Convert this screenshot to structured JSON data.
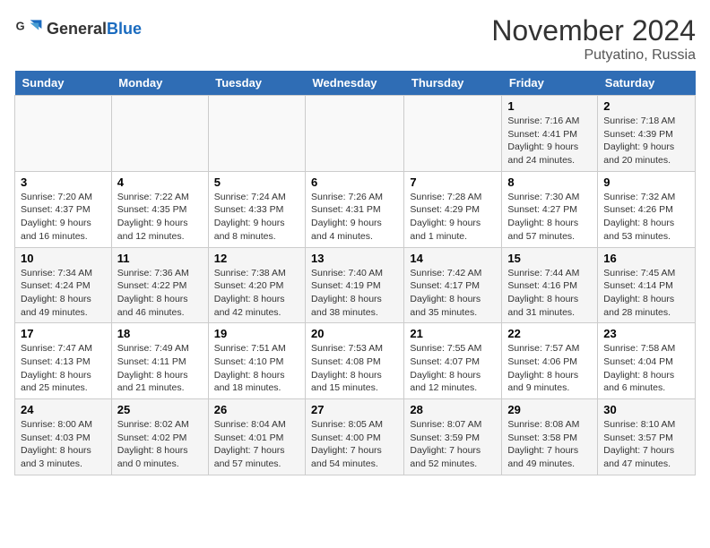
{
  "header": {
    "logo_general": "General",
    "logo_blue": "Blue",
    "month": "November 2024",
    "location": "Putyatino, Russia"
  },
  "weekdays": [
    "Sunday",
    "Monday",
    "Tuesday",
    "Wednesday",
    "Thursday",
    "Friday",
    "Saturday"
  ],
  "weeks": [
    [
      {
        "day": "",
        "info": ""
      },
      {
        "day": "",
        "info": ""
      },
      {
        "day": "",
        "info": ""
      },
      {
        "day": "",
        "info": ""
      },
      {
        "day": "",
        "info": ""
      },
      {
        "day": "1",
        "info": "Sunrise: 7:16 AM\nSunset: 4:41 PM\nDaylight: 9 hours\nand 24 minutes."
      },
      {
        "day": "2",
        "info": "Sunrise: 7:18 AM\nSunset: 4:39 PM\nDaylight: 9 hours\nand 20 minutes."
      }
    ],
    [
      {
        "day": "3",
        "info": "Sunrise: 7:20 AM\nSunset: 4:37 PM\nDaylight: 9 hours\nand 16 minutes."
      },
      {
        "day": "4",
        "info": "Sunrise: 7:22 AM\nSunset: 4:35 PM\nDaylight: 9 hours\nand 12 minutes."
      },
      {
        "day": "5",
        "info": "Sunrise: 7:24 AM\nSunset: 4:33 PM\nDaylight: 9 hours\nand 8 minutes."
      },
      {
        "day": "6",
        "info": "Sunrise: 7:26 AM\nSunset: 4:31 PM\nDaylight: 9 hours\nand 4 minutes."
      },
      {
        "day": "7",
        "info": "Sunrise: 7:28 AM\nSunset: 4:29 PM\nDaylight: 9 hours\nand 1 minute."
      },
      {
        "day": "8",
        "info": "Sunrise: 7:30 AM\nSunset: 4:27 PM\nDaylight: 8 hours\nand 57 minutes."
      },
      {
        "day": "9",
        "info": "Sunrise: 7:32 AM\nSunset: 4:26 PM\nDaylight: 8 hours\nand 53 minutes."
      }
    ],
    [
      {
        "day": "10",
        "info": "Sunrise: 7:34 AM\nSunset: 4:24 PM\nDaylight: 8 hours\nand 49 minutes."
      },
      {
        "day": "11",
        "info": "Sunrise: 7:36 AM\nSunset: 4:22 PM\nDaylight: 8 hours\nand 46 minutes."
      },
      {
        "day": "12",
        "info": "Sunrise: 7:38 AM\nSunset: 4:20 PM\nDaylight: 8 hours\nand 42 minutes."
      },
      {
        "day": "13",
        "info": "Sunrise: 7:40 AM\nSunset: 4:19 PM\nDaylight: 8 hours\nand 38 minutes."
      },
      {
        "day": "14",
        "info": "Sunrise: 7:42 AM\nSunset: 4:17 PM\nDaylight: 8 hours\nand 35 minutes."
      },
      {
        "day": "15",
        "info": "Sunrise: 7:44 AM\nSunset: 4:16 PM\nDaylight: 8 hours\nand 31 minutes."
      },
      {
        "day": "16",
        "info": "Sunrise: 7:45 AM\nSunset: 4:14 PM\nDaylight: 8 hours\nand 28 minutes."
      }
    ],
    [
      {
        "day": "17",
        "info": "Sunrise: 7:47 AM\nSunset: 4:13 PM\nDaylight: 8 hours\nand 25 minutes."
      },
      {
        "day": "18",
        "info": "Sunrise: 7:49 AM\nSunset: 4:11 PM\nDaylight: 8 hours\nand 21 minutes."
      },
      {
        "day": "19",
        "info": "Sunrise: 7:51 AM\nSunset: 4:10 PM\nDaylight: 8 hours\nand 18 minutes."
      },
      {
        "day": "20",
        "info": "Sunrise: 7:53 AM\nSunset: 4:08 PM\nDaylight: 8 hours\nand 15 minutes."
      },
      {
        "day": "21",
        "info": "Sunrise: 7:55 AM\nSunset: 4:07 PM\nDaylight: 8 hours\nand 12 minutes."
      },
      {
        "day": "22",
        "info": "Sunrise: 7:57 AM\nSunset: 4:06 PM\nDaylight: 8 hours\nand 9 minutes."
      },
      {
        "day": "23",
        "info": "Sunrise: 7:58 AM\nSunset: 4:04 PM\nDaylight: 8 hours\nand 6 minutes."
      }
    ],
    [
      {
        "day": "24",
        "info": "Sunrise: 8:00 AM\nSunset: 4:03 PM\nDaylight: 8 hours\nand 3 minutes."
      },
      {
        "day": "25",
        "info": "Sunrise: 8:02 AM\nSunset: 4:02 PM\nDaylight: 8 hours\nand 0 minutes."
      },
      {
        "day": "26",
        "info": "Sunrise: 8:04 AM\nSunset: 4:01 PM\nDaylight: 7 hours\nand 57 minutes."
      },
      {
        "day": "27",
        "info": "Sunrise: 8:05 AM\nSunset: 4:00 PM\nDaylight: 7 hours\nand 54 minutes."
      },
      {
        "day": "28",
        "info": "Sunrise: 8:07 AM\nSunset: 3:59 PM\nDaylight: 7 hours\nand 52 minutes."
      },
      {
        "day": "29",
        "info": "Sunrise: 8:08 AM\nSunset: 3:58 PM\nDaylight: 7 hours\nand 49 minutes."
      },
      {
        "day": "30",
        "info": "Sunrise: 8:10 AM\nSunset: 3:57 PM\nDaylight: 7 hours\nand 47 minutes."
      }
    ]
  ]
}
